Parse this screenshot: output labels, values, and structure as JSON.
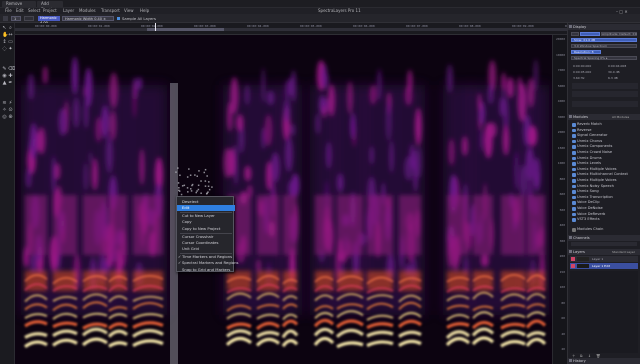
{
  "tabs": [
    "Remove Event",
    "Add Event"
  ],
  "app_title": "SpectraLayers Pro 11",
  "menu": [
    "File",
    "Edit",
    "Select",
    "Project",
    "Layer",
    "Modules",
    "Transport",
    "View",
    "Help"
  ],
  "toolbar": {
    "f1": "1",
    "f2": "Harmonic 4.00",
    "f3": "Harmonic Width 0.40 ±",
    "checkbox_label": "Sample All Layers"
  },
  "timeline_ticks": [
    "00:00:00.000",
    "00:00:01.000",
    "00:00:02.000",
    "00:00:03.000",
    "00:00:04.000",
    "00:00:05.000",
    "00:00:06.000",
    "00:00:07.000",
    "00:00:08.000",
    "00:00:09.000",
    "00:00:10.000"
  ],
  "freq_labels": [
    "20000",
    "10000",
    "7000",
    "5000",
    "4000",
    "3000",
    "2000",
    "1500",
    "1000",
    "800",
    "600",
    "500",
    "400",
    "300",
    "200",
    "150",
    "100",
    "80",
    "60",
    "40",
    "20"
  ],
  "context_menu": {
    "items": [
      {
        "label": "Deselect",
        "checked": false
      },
      {
        "label": "Edit",
        "checked": false,
        "selected": true
      },
      {
        "label": "Cut to New Layer",
        "checked": false
      },
      {
        "label": "Copy",
        "checked": false
      },
      {
        "label": "Copy to New Project",
        "checked": false
      },
      {
        "label": "Cursor Crosshair",
        "checked": false
      },
      {
        "label": "Cursor Coordinates",
        "checked": false
      },
      {
        "label": "Unit Grid",
        "checked": false
      },
      {
        "label": "Time Markers and Regions",
        "checked": true
      },
      {
        "label": "Spectral Markers and Regions",
        "checked": true
      },
      {
        "label": "Snap to Grid and Markers",
        "checked": false
      }
    ]
  },
  "right_panel": {
    "display_header": "Display",
    "display_rows": [
      "Amplitude: Default: ±0",
      "Slow: ±1.0 dB",
      "3.0 Window Spectrum",
      "Resolution: 8",
      "Spectral Spacing 0% ▸"
    ],
    "display_stats": [
      "0:00:00.000",
      "0:00:04.008",
      "0:00:05.000",
      "30.0 dB",
      "3.60 Hz",
      "6.3 dB"
    ],
    "modules_header": "Modules",
    "modules_tab": "All Modules",
    "modules": [
      "Reverb Match",
      "Reverse",
      "Signal Generator",
      "Unmix Chorus",
      "Unmix Components",
      "Unmix Crowd Noise",
      "Unmix Drums",
      "Unmix Levels",
      "Unmix Multiple Voices",
      "Unmix Multichannel Context",
      "Unmix Multiple Voices",
      "Unmix Noisy Speech",
      "Unmix Song",
      "Unmix Transcription",
      "Voice DeClip",
      "Voice DeNoise",
      "Voice DeReverb",
      "VST3 Effects"
    ],
    "modules_chain": "Modules Chain",
    "channels_header": "Channels",
    "layers_header": "Layers",
    "layers_tab": "Standard Layer",
    "layers": [
      "Layer 1",
      "Layer 1 Edit"
    ],
    "history_header": "History"
  }
}
